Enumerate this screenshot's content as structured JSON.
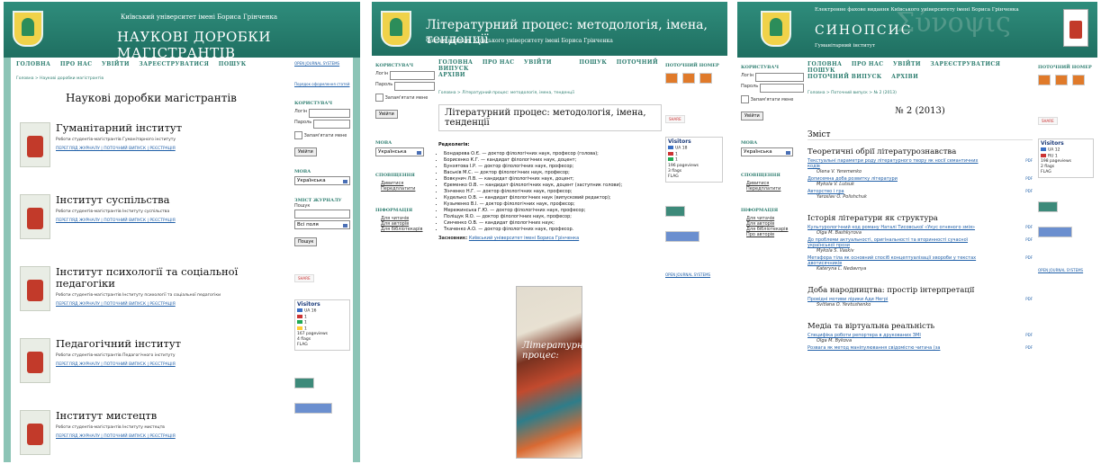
{
  "screen1": {
    "header_sub": "Київський університет імені Бориса Грінченка",
    "header_title": "НАУКОВІ ДОРОБКИ МАГІСТРАНТІВ",
    "nav": [
      "ГОЛОВНА",
      "ПРО НАС",
      "УВІЙТИ",
      "ЗАРЕЄСТРУВАТИСЯ",
      "ПОШУК"
    ],
    "breadcrumb": "Головна > Наукові доробки магістрантів",
    "page_title": "Наукові доробки магістрантів",
    "institutes": [
      {
        "name": "Гуманітарний інститут",
        "desc": "Роботи студентів-магістрантів Гуманітарного інституту",
        "links": "ПЕРЕГЛЯД ЖУРНАЛУ | ПОТОЧНИЙ ВИПУСК | РЕЄСТРАЦІЯ"
      },
      {
        "name": "Інститут суспільства",
        "desc": "Роботи студентів-магістрантів Інституту суспільства",
        "links": "ПЕРЕГЛЯД ЖУРНАЛУ | ПОТОЧНИЙ ВИПУСК | РЕЄСТРАЦІЯ"
      },
      {
        "name": "Інститут психології та соціальної педагогіки",
        "desc": "Роботи студентів-магістрантів Інституту психології та соціальної педагогіки",
        "links": "ПЕРЕГЛЯД ЖУРНАЛУ | ПОТОЧНИЙ ВИПУСК | РЕЄСТРАЦІЯ"
      },
      {
        "name": "Педагогічний інститут",
        "desc": "Роботи студентів-магістрантів Педагогічного інституту",
        "links": "ПЕРЕГЛЯД ЖУРНАЛУ | ПОТОЧНИЙ ВИПУСК | РЕЄСТРАЦІЯ"
      },
      {
        "name": "Інститут мистецтв",
        "desc": "Роботи студентів-магістрантів Інституту мистецтв",
        "links": "ПЕРЕГЛЯД ЖУРНАЛУ | ПОТОЧНИЙ ВИПУСК | РЕЄСТРАЦІЯ"
      }
    ],
    "side": {
      "ojs": "OPEN JOURNAL SYSTEMS",
      "help": "Порядок оформлення статей",
      "user_title": "КОРИСТУВАЧ",
      "login_label": "Логін",
      "password_label": "Пароль",
      "remember": "Запам'ятати мене",
      "login_button": "Увійти",
      "lang_title": "МОВА",
      "lang_value": "Українська",
      "search_title": "ЗМІСТ ЖУРНАЛУ",
      "search_label": "Пошук",
      "search_scope": "Всі поля",
      "search_button": "Пошук",
      "share": "SHARE",
      "visitors_title": "Visitors",
      "visitors_rows": [
        "UA 16",
        "1",
        "1",
        "1"
      ],
      "pageviews": "167 pageviews",
      "flags": "4 flags",
      "flag_counter": "FLAG"
    }
  },
  "screen2": {
    "header_title": "Літературний процес: методологія, імена, тенденції",
    "header_sub": "Фахове видання Київського університету імені Бориса Грінченка",
    "nav": [
      "ГОЛОВНА",
      "ПРО НАС",
      "УВІЙТИ",
      "ПОШУК",
      "ПОТОЧНИЙ ВИПУСК",
      "АРХІВИ"
    ],
    "breadcrumb": "Головна > Літературний процес: методологія, імена, тенденції",
    "page_title": "Літературний процес: методологія, імена, тенденції",
    "board_title": "Редколегія:",
    "board": [
      "Бондарева О.Є. — доктор філологічних наук, професор (голова);",
      "Борисенко К.Г. — кандидат філологічних наук, доцент;",
      "Бунзятова І.Р. — доктор філологічних наук, професор;",
      "Васьків М.С. — доктор філологічних наук, професор;",
      "Вовкунич Л.В. — кандидат філологічних наук, доцент;",
      "Єременко О.В. — кандидат філологічних наук, доцент (заступник голови);",
      "Зінченко Н.Г. — доктор філологічних наук, професор;",
      "Куделько О.В. — кандидат філологічних наук (випусковий редактор);",
      "Кузьменко В.І. — доктор філологічних наук, професор;",
      "Мережинська Г.Ю. — доктор філологічних наук, професор;",
      "Поліщук Я.О. — доктор філологічних наук, професор;",
      "Синченко О.В. — кандидат філологічних наук;",
      "Ткаченко А.О. — доктор філологічних наук, професор."
    ],
    "founder_label": "Засновник:",
    "founder": "Київський університет імені Бориса Грінченка",
    "cover_title": "Літературний процес:",
    "left": {
      "user_title": "КОРИСТУВАЧ",
      "login_label": "Логін",
      "password_label": "Пароль",
      "remember": "Запам'ятати мене",
      "login_button": "Увійти",
      "lang_title": "МОВА",
      "lang_value": "Українська",
      "notify_title": "СПОВІЩЕННЯ",
      "notify": [
        "Дивитися",
        "Передплатити"
      ],
      "info_title": "ІНФОРМАЦІЯ",
      "info": [
        "Для читачів",
        "Для авторів",
        "Для бібліотекарів"
      ]
    },
    "right": {
      "current_title": "ПОТОЧНИЙ НОМЕР",
      "share": "SHARE",
      "visitors_title": "Visitors",
      "visitors_rows": [
        "UA 18",
        "1",
        "1"
      ],
      "pageviews": "196 pageviews",
      "flags": "3 flags",
      "flag_counter": "FLAG",
      "ojs": "OPEN JOURNAL SYSTEMS"
    }
  },
  "screen3": {
    "header_sub": "Електронне фахове видання Київського університету імені Бориса Грінченка",
    "header_title": "СИНОПСИС",
    "header_gr": "Σύνοψις",
    "header_sub2": "Гуманітарний інститут",
    "nav": [
      "ГОЛОВНА",
      "ПРО НАС",
      "УВІЙТИ",
      "ЗАРЕЄСТРУВАТИСЯ",
      "ПОШУК",
      "ПОТОЧНИЙ ВИПУСК",
      "АРХІВИ"
    ],
    "breadcrumb": "Головна > Поточний випуск > № 2 (2013)",
    "page_title": "№ 2 (2013)",
    "toc_title": "Зміст",
    "sections": [
      {
        "title": "Теоретичні обрії літературознавства",
        "articles": [
          {
            "t": "Текстуальні параметри роду літературного твору як носії семантичних кодів",
            "a": "Olena V. Yeremenko"
          },
          {
            "t": "Дописемна доба розвитку літератури",
            "a": "Mykola V. Lutsuk"
          },
          {
            "t": "Авторство і гра",
            "a": "Yaroslav O. Polishchuk"
          }
        ]
      },
      {
        "title": "Історія літератури як структура",
        "articles": [
          {
            "t": "Культурологічний код роману Наталі Тисовської «Укус огняного змія»",
            "a": "Olga M. Bashkyrova"
          },
          {
            "t": "До проблеми актуальності, оригінальності та вторинності сучасної української прози",
            "a": "Mykola S. Vaskiv"
          },
          {
            "t": "Метафора тіла як основний спосіб концептуалізації хвороби у текстах двотисячників",
            "a": "Kateryna L. Nedavnya"
          }
        ]
      },
      {
        "title": "Доба народництва: простір інтерпретації",
        "articles": [
          {
            "t": "Провідні мотиви лірики Ади Негрі",
            "a": "Svitlana O. Yevtushenko"
          }
        ]
      },
      {
        "title": "Медіа та віртуальна реальність",
        "articles": [
          {
            "t": "Специфіка роботи репортера в друкованих ЗМІ",
            "a": "Olga M. Bykova"
          },
          {
            "t": "Розвага як метод маніпулювання свідомістю читача (за",
            "a": ""
          }
        ]
      }
    ],
    "pdf": "PDF",
    "left": {
      "user_title": "КОРИСТУВАЧ",
      "login_label": "Логін",
      "password_label": "Пароль",
      "remember": "Запам'ятати мене",
      "login_button": "Увійти",
      "lang_title": "МОВА",
      "lang_value": "Українська",
      "notify_title": "СПОВІЩЕННЯ",
      "notify": [
        "Дивитися",
        "Передплатити"
      ],
      "info_title": "ІНФОРМАЦІЯ",
      "info": [
        "Для читачів",
        "Для авторів",
        "Для бібліотекарів",
        "Про авторів"
      ]
    },
    "right": {
      "current_title": "ПОТОЧНИЙ НОМЕР",
      "share": "SHARE",
      "visitors_title": "Visitors",
      "visitors_rows": [
        "UA 12",
        "RU 1"
      ],
      "pageviews": "198 pageviews",
      "flags": "2 flags",
      "flag_counter": "FLAG",
      "ojs": "OPEN JOURNAL SYSTEMS"
    }
  }
}
